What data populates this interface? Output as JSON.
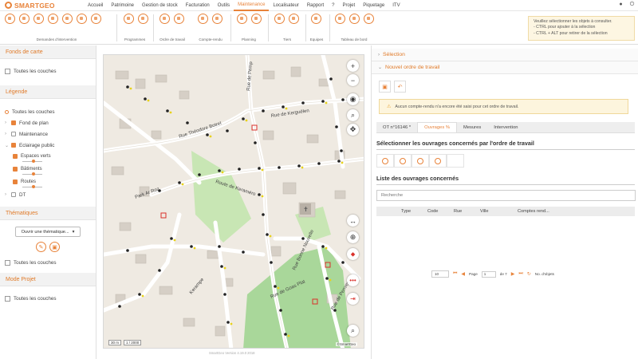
{
  "app": {
    "logo_text": "SMARTGEO"
  },
  "menu": [
    "Accueil",
    "Patrimoine",
    "Gestion de stock",
    "Facturation",
    "Outils",
    "Maintenance",
    "Localisateur",
    "Rapport",
    "?",
    "Projet",
    "Piquetage",
    "ITV"
  ],
  "toolbar": {
    "groups": [
      {
        "label": "Demandes d'intervention"
      },
      {
        "label": "Programmes"
      },
      {
        "label": "Ordre de travail"
      },
      {
        "label": "Compte-rendu"
      },
      {
        "label": "Planning"
      },
      {
        "label": "Tiers"
      },
      {
        "label": "Equipes"
      },
      {
        "label": "Tableau de bord"
      }
    ]
  },
  "info_box": {
    "line1": "Veuillez sélectionner les objets à consulter.",
    "line2": "- CTRL pour ajouter à la sélection",
    "line3": "- CTRL + ALT pour retirer de la sélection"
  },
  "left_panel": {
    "basemap_header": "Fonds de carte",
    "basemap_all": "Toutes les couches",
    "legend_header": "Légende",
    "legend_all": "Toutes les couches",
    "layers": {
      "fond_de_plan": "Fond de plan",
      "maintenance": "Maintenance",
      "eclairage": "Eclairage public",
      "espaces_verts": "Espaces verts",
      "batiments": "Bâtiments",
      "routes": "Routes",
      "dt": "DT"
    },
    "thematic_header": "Thématiques",
    "thematic_button": "Ouvrir une thématique...",
    "thematic_all": "Toutes les couches",
    "project_header": "Mode Projet",
    "project_all": "Toutes les couches"
  },
  "map": {
    "streets": {
      "s1": "Rue Théodore Botrel",
      "s2": "Route de Keraméro",
      "s3": "Rue de Kerguélen",
      "s4": "Park Ar Roz",
      "s5": "Kerampe",
      "s6": "Rue de Pemp",
      "s7": "Rue Bonne Nouvelle",
      "s8": "Rue de Goas Plat",
      "s9": "Rue de Penvern"
    },
    "scale_distance": "30 m",
    "scale_ratio": "1 / 2000",
    "attribution": "©SmartGeo",
    "version": "SmartGeo Version 4.19.0 2018"
  },
  "right_panel": {
    "selection": "Sélection",
    "new_order": "Nouvel ordre de travail",
    "warning": "Aucun compte-rendu n'a encore été saisi pour cet ordre de travail.",
    "tabs": [
      "OT n°16146 *",
      "Ouvrages %",
      "Mesures",
      "Intervention"
    ],
    "select_title": "Sélectionner les ouvrages concernés par l'ordre de travail",
    "list_title": "Liste des ouvrages concernés",
    "search_placeholder": "Recherche",
    "columns": [
      "Type",
      "Code",
      "Rue",
      "Ville",
      "Comptes rend..."
    ],
    "pager": {
      "page_size": "10",
      "page_label": "Page",
      "page_value": "1",
      "of_label": "de 7",
      "count": "No. d'objets"
    }
  }
}
